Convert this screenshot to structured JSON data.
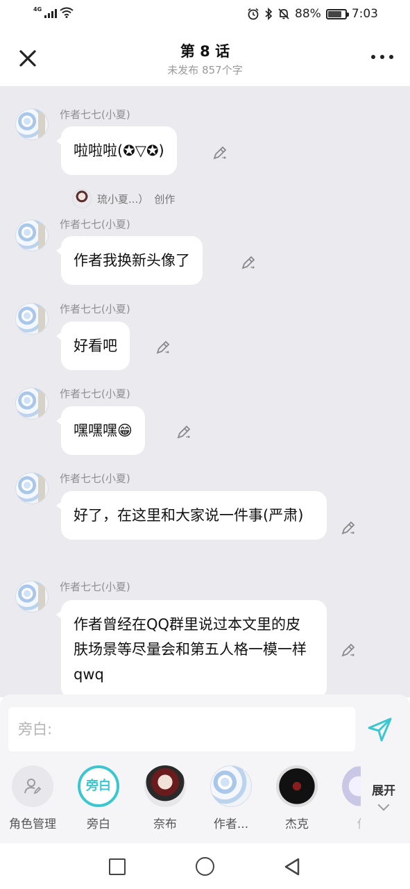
{
  "status_bar": {
    "network": "4G",
    "battery_percent": "88%",
    "time": "7:03"
  },
  "header": {
    "title": "第 8 话",
    "subtitle": "未发布 857个字",
    "close_icon": "close-icon",
    "more_icon": "more-icon"
  },
  "messages": [
    {
      "sender": "作者七七(小夏)",
      "text": "啦啦啦(✪▽✪)"
    },
    {
      "sender": "作者七七(小夏)",
      "text": "作者我换新头像了"
    },
    {
      "sender": "作者七七(小夏)",
      "text": "好看吧"
    },
    {
      "sender": "作者七七(小夏)",
      "text": "嘿嘿嘿😁"
    },
    {
      "sender": "作者七七(小夏)",
      "text": "好了，在这里和大家说一件事(严肃)"
    },
    {
      "sender": "作者七七(小夏)",
      "text": "作者曾经在QQ群里说过本文里的皮肤场景等尽量会和第五人格一模一样qwq"
    }
  ],
  "role_notice": {
    "name": "琉小夏...）",
    "action": "创作"
  },
  "input": {
    "placeholder": "旁白:"
  },
  "roles": [
    {
      "label": "角色管理",
      "icon": "role-manage-icon"
    },
    {
      "label": "旁白",
      "badge": "旁白"
    },
    {
      "label": "奈布"
    },
    {
      "label": "作者..."
    },
    {
      "label": "杰克"
    },
    {
      "label": "作"
    }
  ],
  "expand_label": "展开",
  "colors": {
    "accent": "#3ac7cf",
    "chat_bg": "#ebebef"
  }
}
